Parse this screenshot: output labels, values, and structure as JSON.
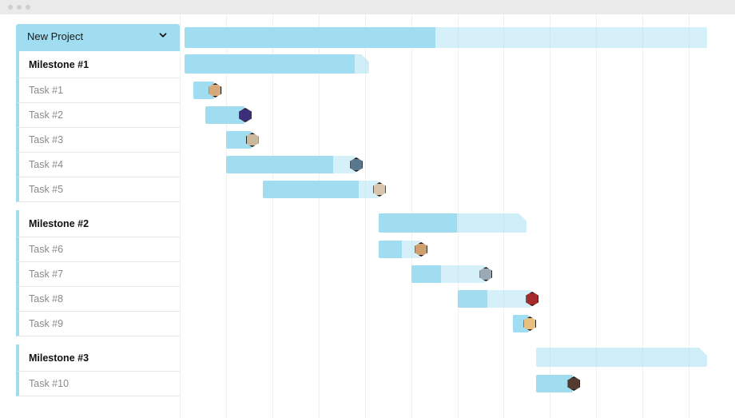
{
  "colors": {
    "accent": "#A1DDF0",
    "accent_light": "rgba(161,221,240,0.45)"
  },
  "project": {
    "title": "New Project"
  },
  "units_per_column": 1,
  "columns": 12,
  "rows": [
    {
      "kind": "project",
      "label": "New Project",
      "bar": {
        "start": 0.1,
        "len": 11.3,
        "progress": 0.48,
        "type": "summary"
      }
    },
    {
      "kind": "milestone",
      "label": "Milestone #1",
      "bar": {
        "start": 0.1,
        "len": 4.0,
        "progress": 0.92,
        "type": "milestone"
      }
    },
    {
      "kind": "task",
      "label": "Task #1",
      "bar": {
        "start": 0.3,
        "len": 0.45,
        "avatar": "#d6a97a"
      }
    },
    {
      "kind": "task",
      "label": "Task #2",
      "bar": {
        "start": 0.55,
        "len": 0.85,
        "avatar": "#3a2e7d"
      }
    },
    {
      "kind": "task",
      "label": "Task #3",
      "bar": {
        "start": 1.0,
        "len": 0.55,
        "avatar": "#c9b79e"
      }
    },
    {
      "kind": "task",
      "label": "Task #4",
      "bar": {
        "start": 1.0,
        "len": 2.8,
        "progress": 0.83,
        "avatar": "#59788e"
      }
    },
    {
      "kind": "task",
      "label": "Task #5",
      "bar": {
        "start": 1.8,
        "len": 2.5,
        "progress": 0.83,
        "avatar": "#d9c5ad"
      }
    },
    {
      "kind": "spacer"
    },
    {
      "kind": "milestone",
      "label": "Milestone #2",
      "bar": {
        "start": 4.3,
        "len": 3.2,
        "progress": 0.53,
        "type": "milestone"
      }
    },
    {
      "kind": "task",
      "label": "Task #6",
      "bar": {
        "start": 4.3,
        "len": 0.9,
        "progress": 0.55,
        "avatar": "#cfa06f"
      }
    },
    {
      "kind": "task",
      "label": "Task #7",
      "bar": {
        "start": 5.0,
        "len": 1.6,
        "progress": 0.4,
        "avatar": "#9aa9b4"
      }
    },
    {
      "kind": "task",
      "label": "Task #8",
      "bar": {
        "start": 6.0,
        "len": 1.6,
        "progress": 0.4,
        "avatar": "#a52a2a"
      }
    },
    {
      "kind": "task",
      "label": "Task #9",
      "bar": {
        "start": 7.2,
        "len": 0.35,
        "avatar": "#e7c07e"
      }
    },
    {
      "kind": "spacer"
    },
    {
      "kind": "milestone",
      "label": "Milestone #3",
      "bar": {
        "start": 7.7,
        "len": 3.7,
        "progress": 0.0,
        "type": "milestone"
      }
    },
    {
      "kind": "task",
      "label": "Task #10",
      "bar": {
        "start": 7.7,
        "len": 0.8,
        "avatar": "#533b32"
      }
    }
  ]
}
